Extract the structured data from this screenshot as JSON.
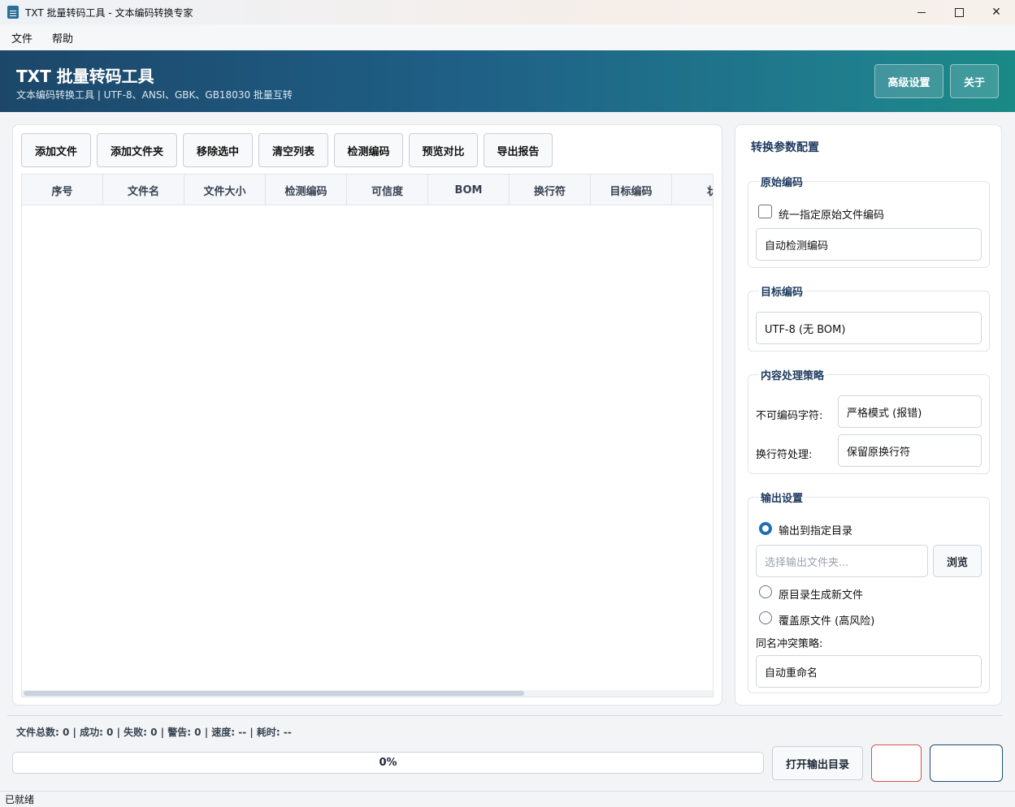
{
  "window": {
    "title": "TXT 批量转码工具 - 文本编码转换专家",
    "close_glyph": "✕"
  },
  "menu": [
    "文件",
    "帮助"
  ],
  "header": {
    "title": "TXT 批量转码工具",
    "subtitle": "文本编码转换工具 | UTF-8、ANSI、GBK、GB18030 批量互转",
    "advanced_label": "高级设置",
    "about_label": "关于"
  },
  "toolbar": {
    "add_file": "添加文件",
    "add_folder": "添加文件夹",
    "remove_selected": "移除选中",
    "clear_list": "清空列表",
    "detect_encoding": "检测编码",
    "preview_compare": "预览对比",
    "export_report": "导出报告"
  },
  "table": {
    "columns": [
      "序号",
      "文件名",
      "文件大小",
      "检测编码",
      "可信度",
      "BOM",
      "换行符",
      "目标编码",
      "状"
    ],
    "rows": []
  },
  "config": {
    "title": "转换参数配置",
    "source": {
      "label": "原始编码",
      "checkbox_label": "统一指定原始文件编码",
      "value": "自动检测编码"
    },
    "target": {
      "label": "目标编码",
      "value": "UTF-8 (无 BOM)"
    },
    "content": {
      "label": "内容处理策略",
      "unencodable_label": "不可编码字符:",
      "unencodable_value": "严格模式 (报错)",
      "newline_label": "换行符处理:",
      "newline_value": "保留原换行符"
    },
    "output": {
      "label": "输出设置",
      "radio_dir": "输出到指定目录",
      "dir_placeholder": "选择输出文件夹...",
      "browse_label": "浏览",
      "radio_new": "原目录生成新文件",
      "radio_overwrite": "覆盖原文件 (高风险)",
      "conflict_label": "同名冲突策略:",
      "conflict_value": "自动重命名"
    }
  },
  "stats": "文件总数: 0 | 成功: 0 | 失败: 0 | 警告: 0 | 速度: -- | 耗时: --",
  "progress": {
    "text": "0%",
    "fraction": 0
  },
  "bottom": {
    "open_output": "打开输出目录"
  },
  "status": "已就绪"
}
